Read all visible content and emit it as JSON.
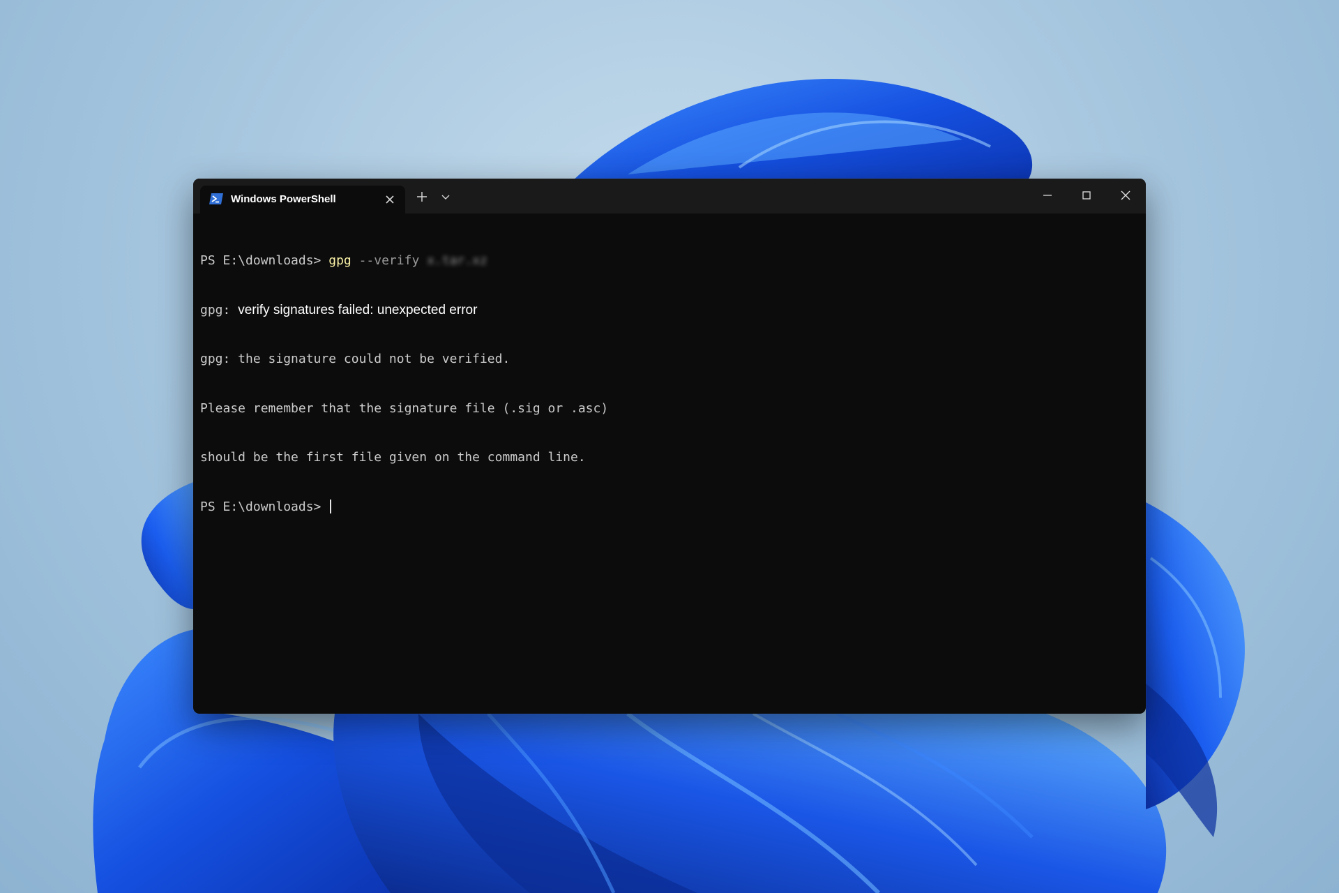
{
  "window": {
    "tab_title": "Windows PowerShell"
  },
  "console": {
    "prompt": "PS E:\\downloads> ",
    "command": "gpg",
    "flag": " --verify ",
    "argument_obscured": "x.tar.xz",
    "error_prefix": "gpg: ",
    "error_message": "verify signatures failed: unexpected error",
    "lines": [
      "gpg: the signature could not be verified.",
      "Please remember that the signature file (.sig or .asc)",
      "should be the first file given on the command line."
    ],
    "final_prompt": "PS E:\\downloads> "
  },
  "colors": {
    "terminal_background": "#0c0c0c",
    "titlebar": "#1a1a1a",
    "command_highlight": "#f9f1a5",
    "parameter_gray": "#9a9a9a",
    "text": "#cccccc",
    "powershell_icon_blue": "#2f6fd6",
    "wallpaper_blue": "#1f5bd8"
  },
  "icons": {
    "tab": "powershell-icon",
    "tab_close": "close-icon",
    "new_tab": "plus-icon",
    "dropdown": "chevron-down-icon",
    "minimize": "minimize-icon",
    "maximize": "maximize-icon",
    "close": "close-icon"
  }
}
